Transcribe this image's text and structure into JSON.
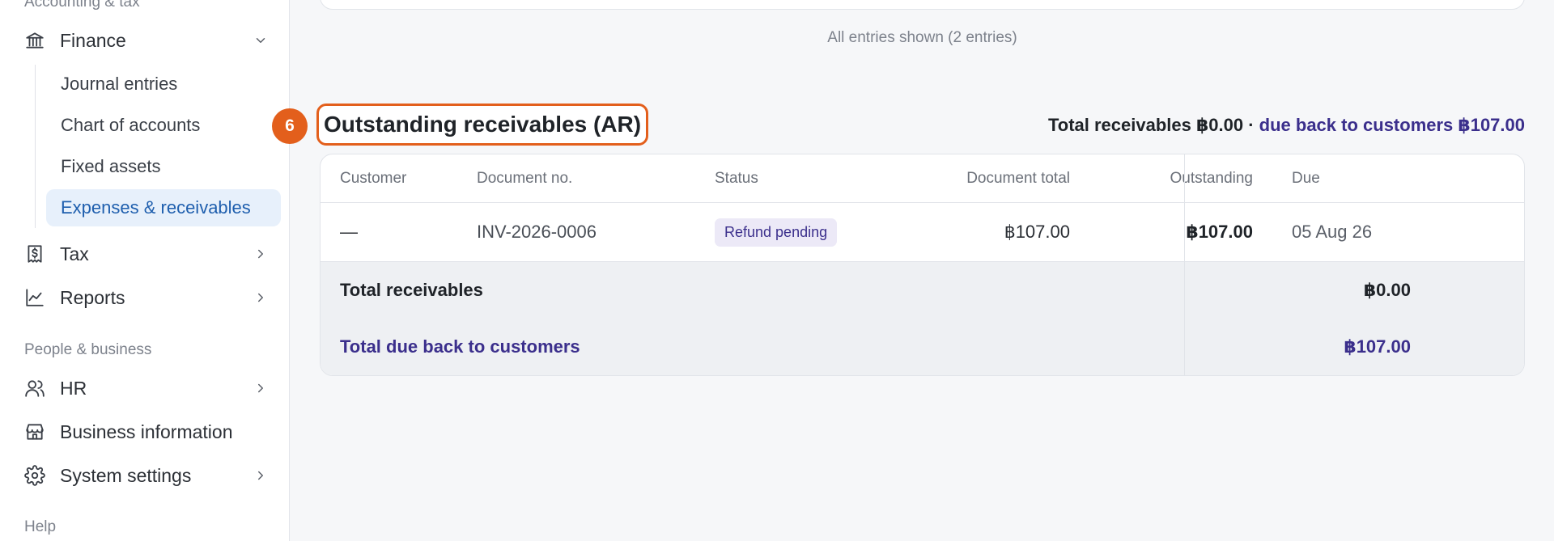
{
  "sidebar": {
    "section_accounting": "Accounting & tax",
    "finance": {
      "label": "Finance",
      "icon": "bank-icon",
      "expanded": true
    },
    "finance_children": [
      {
        "label": "Journal entries",
        "active": false
      },
      {
        "label": "Chart of accounts",
        "active": false
      },
      {
        "label": "Fixed assets",
        "active": false
      },
      {
        "label": "Expenses & receivables",
        "active": true
      }
    ],
    "tax": {
      "label": "Tax",
      "icon": "receipt-dollar-icon"
    },
    "reports": {
      "label": "Reports",
      "icon": "line-chart-icon"
    },
    "section_people": "People & business",
    "hr": {
      "label": "HR",
      "icon": "users-icon"
    },
    "business_info": {
      "label": "Business information",
      "icon": "storefront-icon"
    },
    "system_settings": {
      "label": "System settings",
      "icon": "gear-icon"
    },
    "section_help": "Help"
  },
  "main": {
    "entries_note": "All entries shown (2 entries)",
    "step_number": "6",
    "section_title": "Outstanding receivables (AR)",
    "totals_summary": {
      "receivables_text": "Total receivables ฿0.00",
      "separator": " · ",
      "due_back_text": "due back to customers ฿107.00"
    },
    "table": {
      "headers": {
        "customer": "Customer",
        "document_no": "Document no.",
        "status": "Status",
        "document_total": "Document total",
        "outstanding": "Outstanding",
        "due": "Due"
      },
      "rows": [
        {
          "customer": "—",
          "document_no": "INV-2026-0006",
          "status": "Refund pending",
          "document_total": "฿107.00",
          "outstanding": "฿107.00",
          "due": "05 Aug 26"
        }
      ],
      "footer": {
        "total_receivables_label": "Total receivables",
        "total_receivables_value": "฿0.00",
        "total_due_back_label": "Total due back to customers",
        "total_due_back_value": "฿107.00"
      }
    }
  },
  "colors": {
    "accent_orange": "#e35f1c",
    "active_nav_bg": "#e7f0fb",
    "active_nav_text": "#1f5fae",
    "due_back_purple": "#3b2f8c"
  }
}
